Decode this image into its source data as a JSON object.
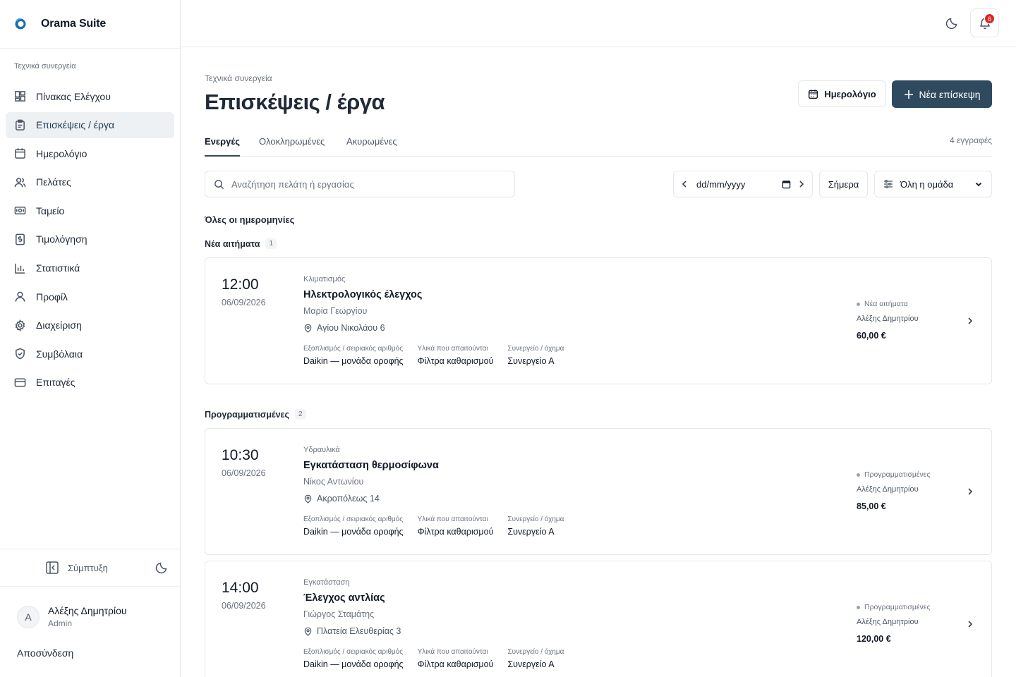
{
  "app": {
    "name": "Orama Suite"
  },
  "sidebar": {
    "section": "Τεχνικά συνεργεία",
    "items": [
      {
        "label": "Πίνακας Ελέγχου",
        "icon": "dashboard-icon"
      },
      {
        "label": "Επισκέψεις / έργα",
        "icon": "clipboard-icon",
        "active": true
      },
      {
        "label": "Ημερολόγιο",
        "icon": "calendar-icon"
      },
      {
        "label": "Πελάτες",
        "icon": "users-icon"
      },
      {
        "label": "Ταμείο",
        "icon": "cash-icon"
      },
      {
        "label": "Τιμολόγηση",
        "icon": "invoice-icon"
      },
      {
        "label": "Στατιστικά",
        "icon": "bar-chart-icon"
      },
      {
        "label": "Προφίλ",
        "icon": "user-icon"
      },
      {
        "label": "Διαχείριση",
        "icon": "gear-icon"
      },
      {
        "label": "Συμβόλαια",
        "icon": "shield-icon"
      },
      {
        "label": "Επιταγές",
        "icon": "credit-card-icon"
      }
    ],
    "collapse_label": "Σύμπτυξη",
    "user": {
      "initial": "A",
      "name": "Αλέξης Δημητρίου",
      "role": "Admin"
    },
    "logout_label": "Αποσύνδεση"
  },
  "topbar": {
    "notifications": "6"
  },
  "page": {
    "breadcrumb": "Τεχνικά συνεργεία",
    "title": "Επισκέψεις / έργα",
    "calendar_button": "Ημερολόγιο",
    "new_button": "Νέα επίσκεψη"
  },
  "tabs": [
    {
      "label": "Ενεργές",
      "active": true
    },
    {
      "label": "Ολοκληρωμένες"
    },
    {
      "label": "Ακυρωμένες"
    }
  ],
  "records_count": "4 εγγραφές",
  "filters": {
    "search_placeholder": "Αναζήτηση πελάτη ή εργασίας",
    "date_value": "dd/mm/yyyy",
    "today_label": "Σήμερα",
    "team_value": "Όλη η ομάδα"
  },
  "all_dates_label": "Όλες οι ημερομηνίες",
  "field_labels": {
    "equipment": "Εξοπλισμός / σειριακός αριθμός",
    "materials": "Υλικά που απαιτούνται",
    "team": "Συνεργείο / όχημα"
  },
  "groups": [
    {
      "title": "Νέα αιτήματα",
      "count": "1",
      "cards": [
        {
          "time": "12:00",
          "date": "06/09/2026",
          "category": "Κλιματισμός",
          "title": "Ηλεκτρολογικός έλεγχος",
          "client": "Μαρία Γεωργίου",
          "address": "Αγίου Νικολάου 6",
          "equipment": "Daikin — μονάδα οροφής",
          "materials": "Φίλτρα καθαρισμού",
          "team": "Συνεργείο Α",
          "status": "Νέα αιτήματα",
          "technician": "Αλέξης Δημητρίου",
          "price": "60,00 €"
        }
      ]
    },
    {
      "title": "Προγραμματισμένες",
      "count": "2",
      "cards": [
        {
          "time": "10:30",
          "date": "06/09/2026",
          "category": "Υδραυλικά",
          "title": "Εγκατάσταση θερμοσίφωνα",
          "client": "Νίκος Αντωνίου",
          "address": "Ακροπόλεως 14",
          "equipment": "Daikin — μονάδα οροφής",
          "materials": "Φίλτρα καθαρισμού",
          "team": "Συνεργείο Α",
          "status": "Προγραμματισμένες",
          "technician": "Αλέξης Δημητρίου",
          "price": "85,00 €"
        },
        {
          "time": "14:00",
          "date": "06/09/2026",
          "category": "Εγκατάσταση",
          "title": "Έλεγχος αντλίας",
          "client": "Γιώργος Σταμάτης",
          "address": "Πλατεία Ελευθερίας 3",
          "equipment": "Daikin — μονάδα οροφής",
          "materials": "Φίλτρα καθαρισμού",
          "team": "Συνεργείο Α",
          "status": "Προγραμματισμένες",
          "technician": "Αλέξης Δημητρίου",
          "price": "120,00 €"
        }
      ]
    }
  ]
}
